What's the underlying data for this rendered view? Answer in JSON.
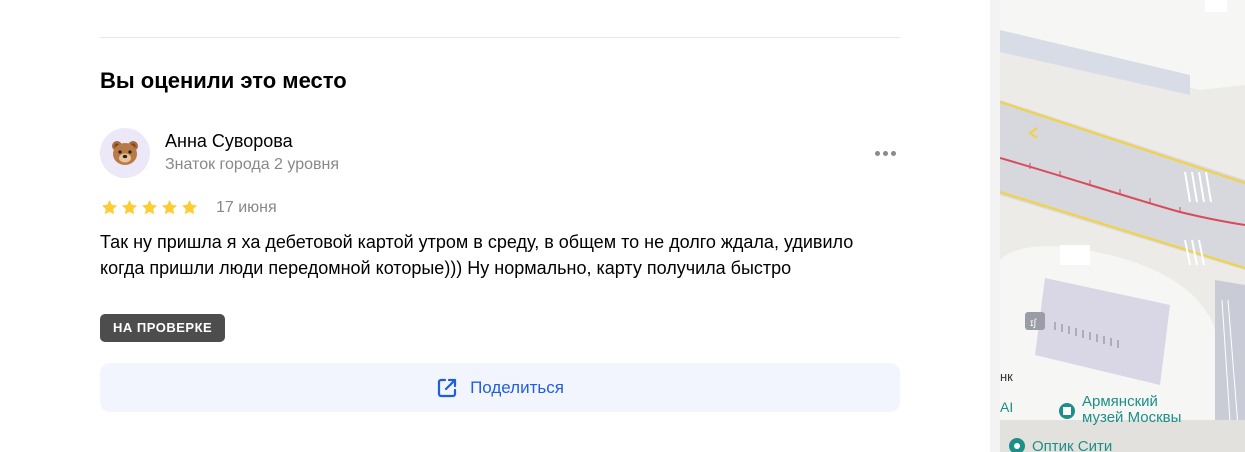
{
  "rated": {
    "title": "Вы оценили это место"
  },
  "review": {
    "author_name": "Анна Суворова",
    "author_rank": "Знаток города 2 уровня",
    "rating": 5,
    "rating_max": 5,
    "date": "17 июня",
    "text": "Так ну пришла я ха дебетовой картой утром в среду, в общем то не долго ждала, удивило когда пришли люди передомной которые))) Ну нормально, карту получила быстро",
    "status": "НА ПРОВЕРКЕ",
    "avatar_icon": "bear-face-icon",
    "more_icon": "more-dots-icon"
  },
  "share": {
    "label": "Поделиться",
    "icon": "share-arrow-icon"
  },
  "map": {
    "poi_armenian_museum": "Армянский музей Москвы",
    "poi_optik": "Оптик Сити",
    "edge_label_nk": "нк",
    "edge_label_ai": "AI"
  },
  "colors": {
    "star": "#fc3",
    "accent": "#1f5fdf",
    "badge": "#4d4d4d",
    "share_bg": "#f2f5fd",
    "map_poi": "#1d8f87"
  }
}
